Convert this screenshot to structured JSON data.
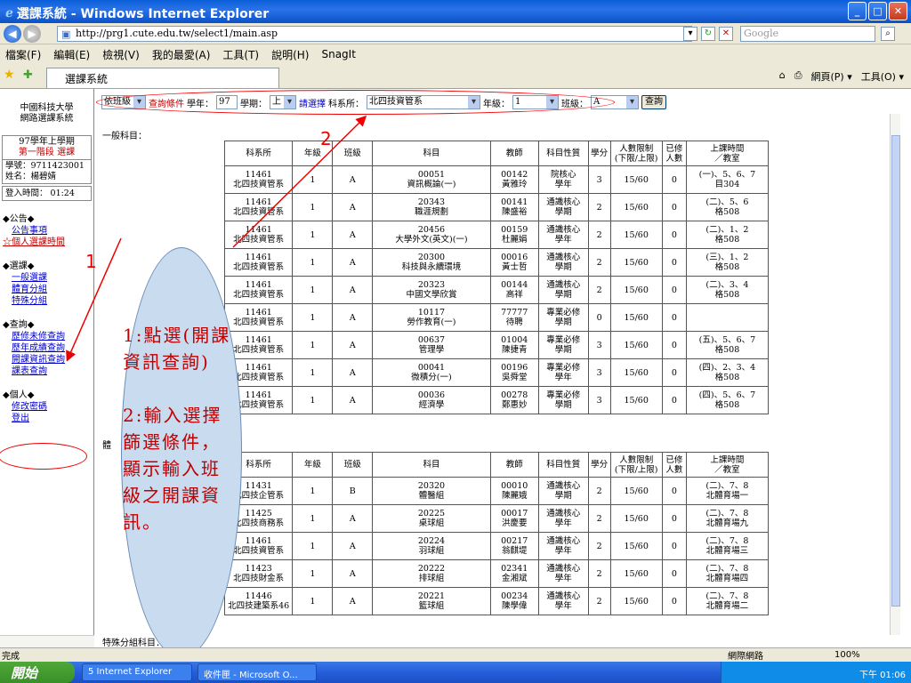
{
  "window": {
    "title": "選課系統 - Windows Internet Explorer",
    "buttons": [
      "_",
      "□",
      "✕"
    ]
  },
  "address": {
    "url": "http://prg1.cute.edu.tw/select1/main.asp",
    "search_placeholder": "Google"
  },
  "menu": [
    "檔案(F)",
    "編輯(E)",
    "檢視(V)",
    "我的最愛(A)",
    "工具(T)",
    "說明(H)",
    "SnagIt"
  ],
  "tab": {
    "label": "選課系統"
  },
  "toolbar_right": [
    "網頁(P) ▾",
    "工具(O) ▾"
  ],
  "left": {
    "school_line1": "中國科技大學",
    "school_line2": "網路選課系統",
    "term_line1": "97學年上學期",
    "term_line2": "第一階段 選課",
    "student_id": "學號：9711423001",
    "student_name": "姓名：楊碧婧",
    "login_time": "登入時間： 01:24",
    "groups": [
      {
        "header": "◆公告◆",
        "items": [
          "公告事項",
          "☆個人選課時間"
        ]
      },
      {
        "header": "◆選課◆",
        "items": [
          "一般選課",
          "體育分組",
          "特殊分組"
        ]
      },
      {
        "header": "◆查詢◆",
        "items": [
          "歷修未修查詢",
          "歷年成績查詢",
          "開課資訊查詢",
          "課表查詢"
        ]
      },
      {
        "header": "◆個人◆",
        "items": [
          "修改密碼",
          "登出"
        ]
      }
    ]
  },
  "query": {
    "mode": "依班級",
    "condition_label": "查詢條件",
    "year_label": "學年：",
    "year_value": "97",
    "term_label": "學期：",
    "term_value": "上",
    "dept_prompt": "請選擇",
    "dept_label": "科系所：",
    "dept_value": "北四技資管系",
    "grade_label": "年級：",
    "grade_value": "1",
    "class_label": "班級：",
    "class_value": "A",
    "button": "查詢"
  },
  "section1_label": "一般科目：",
  "section2_label": "體",
  "section3_label": "特殊分組科目：",
  "headers": [
    "科系所",
    "年級",
    "班級",
    "科目",
    "教師",
    "科目性質",
    "學分",
    "人數限制\n(下限/上限)",
    "已修\n人數",
    "上課時間\n／教室"
  ],
  "general_courses": [
    [
      "11461\n北四技資管系",
      "1",
      "A",
      "00051\n資訊概論(一)",
      "00142\n黃雅玲",
      "院核心\n學年",
      "3",
      "15/60",
      "0",
      "(一)、5、6、7\n目304"
    ],
    [
      "11461\n北四技資管系",
      "1",
      "A",
      "20343\n職涯規劃",
      "00141\n陳盛裕",
      "通識核心\n學期",
      "2",
      "15/60",
      "0",
      "(二)、5、6\n格508"
    ],
    [
      "11461\n北四技資管系",
      "1",
      "A",
      "20456\n大學外文(英文)(一)",
      "00159\n杜麗娟",
      "通識核心\n學年",
      "2",
      "15/60",
      "0",
      "(二)、1、2\n格508"
    ],
    [
      "11461\n北四技資管系",
      "1",
      "A",
      "20300\n科技與永續環境",
      "00016\n黃士哲",
      "通識核心\n學期",
      "2",
      "15/60",
      "0",
      "(三)、1、2\n格508"
    ],
    [
      "11461\n北四技資管系",
      "1",
      "A",
      "20323\n中國文學欣賞",
      "00144\n高祥",
      "通識核心\n學期",
      "2",
      "15/60",
      "0",
      "(二)、3、4\n格508"
    ],
    [
      "11461\n北四技資管系",
      "1",
      "A",
      "10117\n勞作教育(一)",
      "77777\n待聘",
      "專業必修\n學期",
      "0",
      "15/60",
      "0",
      ""
    ],
    [
      "11461\n北四技資管系",
      "1",
      "A",
      "00637\n管理學",
      "01004\n陳捷青",
      "專業必修\n學期",
      "3",
      "15/60",
      "0",
      "(五)、5、6、7\n格508"
    ],
    [
      "11461\n北四技資管系",
      "1",
      "A",
      "00041\n微積分(一)",
      "00196\n吳舜堂",
      "專業必修\n學年",
      "3",
      "15/60",
      "0",
      "(四)、2、3、4\n格508"
    ],
    [
      "11461\n北四技資管系",
      "1",
      "A",
      "00036\n經濟學",
      "00278\n鄭惠妙",
      "專業必修\n學期",
      "3",
      "15/60",
      "0",
      "(四)、5、6、7\n格508"
    ]
  ],
  "pe_courses": [
    [
      "11431\n北四技企管系",
      "1",
      "B",
      "20320\n體醫組",
      "00010\n陳麗娥",
      "通識核心\n學期",
      "2",
      "15/60",
      "0",
      "(二)、7、8\n北體育場一"
    ],
    [
      "11425\n北四技商務系",
      "1",
      "A",
      "20225\n桌球組",
      "00017\n洪慶要",
      "通識核心\n學年",
      "2",
      "15/60",
      "0",
      "(二)、7、8\n北體育場九"
    ],
    [
      "11461\n北四技資管系",
      "1",
      "A",
      "20224\n羽球組",
      "00217\n翁麒堤",
      "通識核心\n學年",
      "2",
      "15/60",
      "0",
      "(二)、7、8\n北體育場三"
    ],
    [
      "11423\n北四技財金系",
      "1",
      "A",
      "20222\n排球組",
      "02341\n金湘斌",
      "通識核心\n學年",
      "2",
      "15/60",
      "0",
      "(二)、7、8\n北體育場四"
    ],
    [
      "11446\n北四技建築系46",
      "1",
      "A",
      "20221\n籃球組",
      "00234\n陳學偉",
      "通識核心\n學年",
      "2",
      "15/60",
      "0",
      "(二)、7、8\n北體育場二"
    ]
  ],
  "annotation": {
    "bubble_text": "1:點選(開課資訊查詢)\n\n2:輸入選擇篩選條件，顯示輸入班級之開課資訊。",
    "marker1": "1",
    "marker2": "2",
    "color": "#e00000"
  },
  "status": {
    "text": "完成",
    "zone": "網際網路",
    "zoom": "100%"
  },
  "taskbar": {
    "start": "開始",
    "tasks": [
      "5 Internet Explorer",
      "收件匣 - Microsoft O..."
    ],
    "clock": "下午 01:06"
  }
}
